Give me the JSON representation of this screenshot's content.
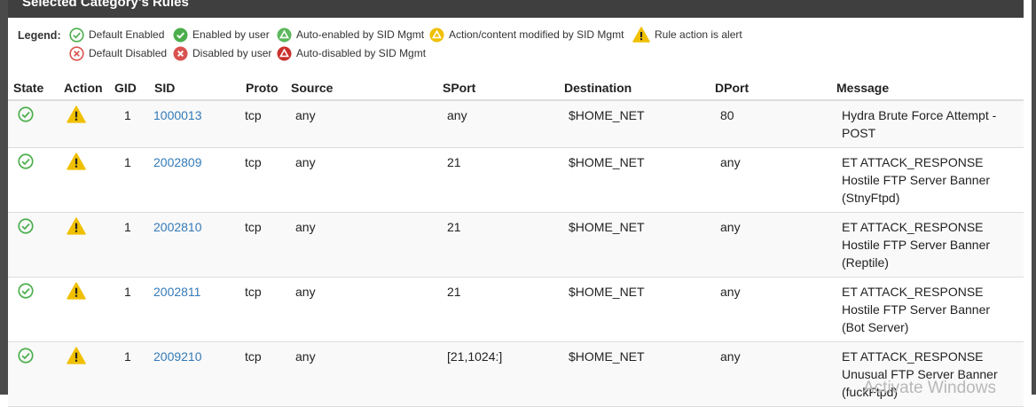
{
  "panel": {
    "title": "Selected Category's Rules"
  },
  "legend": {
    "label": "Legend:",
    "items": [
      {
        "icon": "check-circle-outline-icon",
        "label": "Default Enabled",
        "color": "#4cae4c"
      },
      {
        "icon": "check-circle-solid-icon",
        "label": "Enabled by user",
        "color": "#4cae4c"
      },
      {
        "icon": "triangle-circle-green-icon",
        "label": "Auto-enabled by SID Mgmt",
        "color": "#5cb85c"
      },
      {
        "icon": "triangle-circle-yellow-icon",
        "label": "Action/content modified by SID Mgmt",
        "color": "#f0c000"
      },
      {
        "icon": "warning-triangle-icon",
        "label": "Rule action is alert",
        "color": "#f0c000"
      },
      {
        "icon": "x-circle-outline-icon",
        "label": "Default Disabled",
        "color": "#d9534f"
      },
      {
        "icon": "x-circle-solid-icon",
        "label": "Disabled by user",
        "color": "#d9534f"
      },
      {
        "icon": "triangle-circle-red-icon",
        "label": "Auto-disabled by SID Mgmt",
        "color": "#c9302c"
      }
    ]
  },
  "table": {
    "columns": [
      "State",
      "Action",
      "GID",
      "SID",
      "Proto",
      "Source",
      "SPort",
      "Destination",
      "DPort",
      "Message"
    ],
    "rows": [
      {
        "gid": "1",
        "sid": "1000013",
        "proto": "tcp",
        "source": "any",
        "sport": "any",
        "destination": "$HOME_NET",
        "dport": "80",
        "message": [
          "Hydra Brute Force Attempt -",
          "POST"
        ]
      },
      {
        "gid": "1",
        "sid": "2002809",
        "proto": "tcp",
        "source": "any",
        "sport": "21",
        "destination": "$HOME_NET",
        "dport": "any",
        "message": [
          "ET ATTACK_RESPONSE",
          "Hostile FTP Server Banner",
          "(StnyFtpd)"
        ]
      },
      {
        "gid": "1",
        "sid": "2002810",
        "proto": "tcp",
        "source": "any",
        "sport": "21",
        "destination": "$HOME_NET",
        "dport": "any",
        "message": [
          "ET ATTACK_RESPONSE",
          "Hostile FTP Server Banner",
          "(Reptile)"
        ]
      },
      {
        "gid": "1",
        "sid": "2002811",
        "proto": "tcp",
        "source": "any",
        "sport": "21",
        "destination": "$HOME_NET",
        "dport": "any",
        "message": [
          "ET ATTACK_RESPONSE",
          "Hostile FTP Server Banner",
          "(Bot Server)"
        ]
      },
      {
        "gid": "1",
        "sid": "2009210",
        "proto": "tcp",
        "source": "any",
        "sport": "[21,1024:]",
        "destination": "$HOME_NET",
        "dport": "any",
        "message": [
          "ET ATTACK_RESPONSE",
          "Unusual FTP Server Banner",
          "(fuckFtpd)"
        ]
      }
    ]
  },
  "watermark": "Activate Windows"
}
